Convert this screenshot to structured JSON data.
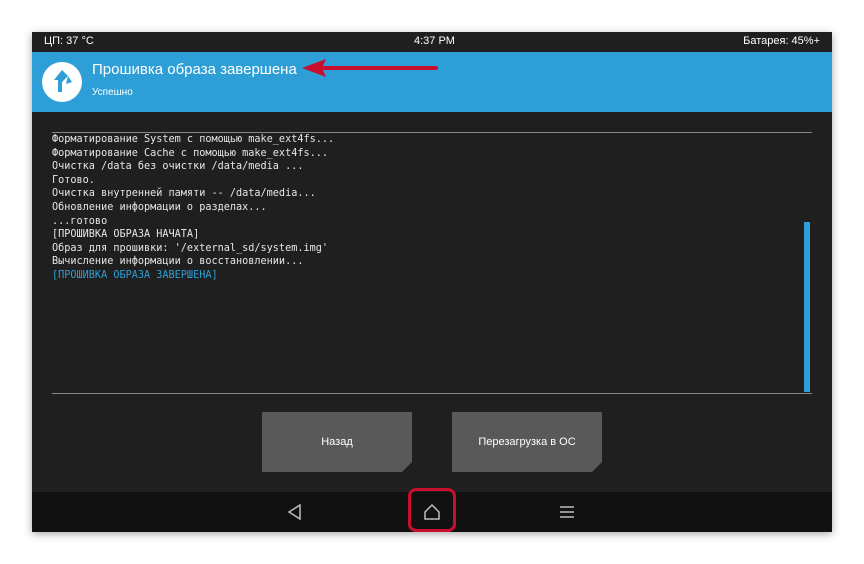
{
  "statusbar": {
    "cpu": "ЦП: 37 °C",
    "time": "4:37 PM",
    "battery": "Батарея: 45%+"
  },
  "header": {
    "title": "Прошивка образа завершена",
    "subtitle": "Успешно"
  },
  "console": {
    "lines": [
      "Форматирование System с помощью make_ext4fs...",
      "Форматирование Cache с помощью make_ext4fs...",
      "Очистка /data без очистки /data/media ...",
      "Готово.",
      "Очистка внутренней памяти -- /data/media...",
      "Обновление информации о разделах...",
      "...готово",
      "[ПРОШИВКА ОБРАЗА НАЧАТА]",
      "Образ для прошивки: '/external_sd/system.img'",
      "Вычисление информации о восстановлении..."
    ],
    "highlight": "[ПРОШИВКА ОБРАЗА ЗАВЕРШЕНА]"
  },
  "buttons": {
    "back": "Назад",
    "reboot": "Перезагрузка в ОС"
  },
  "colors": {
    "accent": "#2d9fd6",
    "annotation": "#c8102e"
  },
  "icons": {
    "logo": "twrp-logo-icon",
    "back": "back-triangle-icon",
    "home": "home-icon",
    "menu": "menu-icon"
  }
}
